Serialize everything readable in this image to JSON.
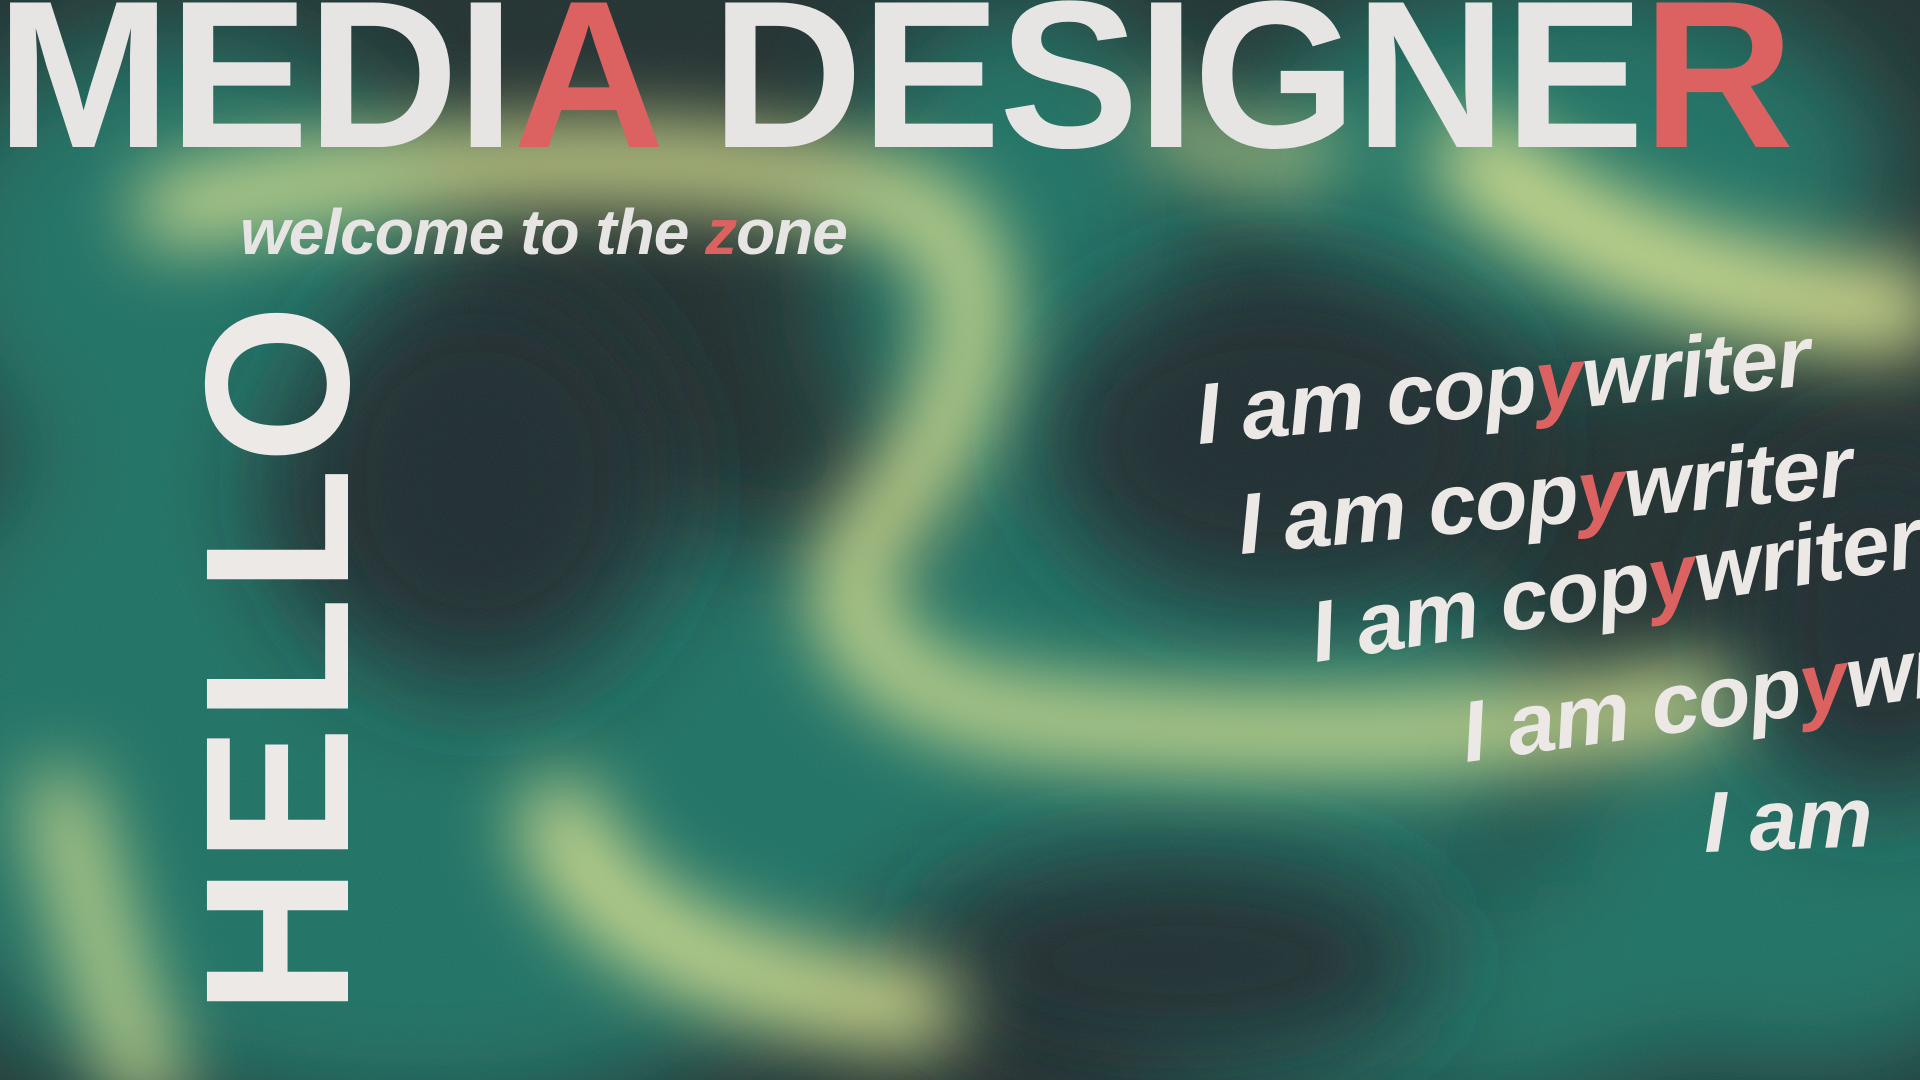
{
  "colors": {
    "background_dark": "#1f2e2e",
    "teal": "#1f6f62",
    "lime_glow": "#d3de8c",
    "text_light": "#e7e5e4",
    "accent_red": "#dc6262"
  },
  "headline": {
    "part1": "MEDI",
    "accent1": "A",
    "part2": " DESIGNE",
    "accent2": "R"
  },
  "tagline": {
    "before": "welcome to the ",
    "accent": "z",
    "after": "one"
  },
  "vertical_word": "HELLO",
  "copywriter_lines": [
    {
      "before": "I am cop",
      "accent": "y",
      "after": "writer"
    },
    {
      "before": "I am cop",
      "accent": "y",
      "after": "writer"
    },
    {
      "before": "I am cop",
      "accent": "y",
      "after": "writer"
    },
    {
      "before": "I am cop",
      "accent": "y",
      "after": "writer"
    },
    {
      "before": "I am",
      "accent": "",
      "after": ""
    }
  ]
}
